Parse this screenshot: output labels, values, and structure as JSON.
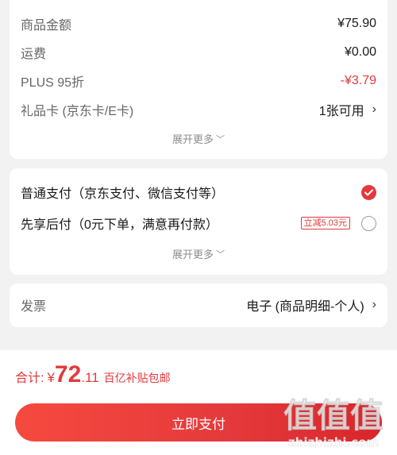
{
  "summary": {
    "items": [
      {
        "label": "商品金额",
        "value": "¥75.90"
      },
      {
        "label": "运费",
        "value": "¥0.00"
      },
      {
        "label": "PLUS 95折",
        "value": "-¥3.79"
      },
      {
        "label": "礼品卡 (京东卡/E卡)",
        "value": "1张可用"
      }
    ],
    "more_label": "展开更多"
  },
  "payment": {
    "options": [
      {
        "label": "普通支付（京东支付、微信支付等）",
        "selected": true
      },
      {
        "label": "先享后付（0元下单，满意再付款）",
        "promo": "立减5.03元",
        "selected": false
      }
    ],
    "more_label": "展开更多"
  },
  "invoice": {
    "label": "发票",
    "value": "电子 (商品明细-个人)"
  },
  "footer": {
    "total_label": "合计:",
    "currency": "¥",
    "amount_int": "72",
    "amount_dec": ".11",
    "subsidy_note": "百亿补贴包邮",
    "pay_button_label": "立即支付"
  },
  "watermark": {
    "glyphs": "值值值",
    "site": "zhizhizhi.com"
  },
  "colors": {
    "accent": "#e4393c",
    "background": "#f2f2f2"
  }
}
